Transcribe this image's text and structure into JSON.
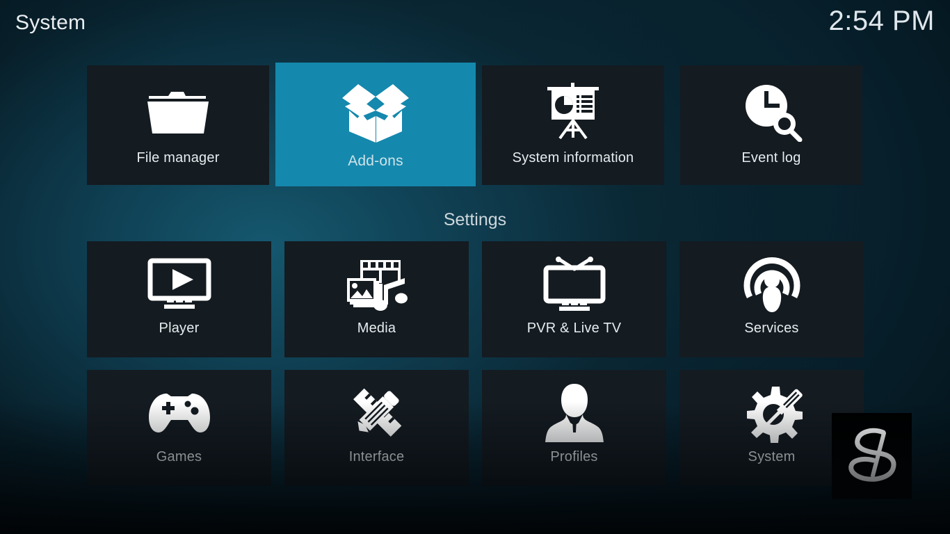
{
  "header": {
    "title": "System",
    "clock": "2:54 PM"
  },
  "colors": {
    "accent": "#1588ad",
    "tile_bg": "#141b21",
    "text": "#e6ecef",
    "background_dark": "#041520"
  },
  "top_row": [
    {
      "label": "File manager",
      "icon": "folder-icon",
      "selected": false
    },
    {
      "label": "Add-ons",
      "icon": "open-box-icon",
      "selected": true
    },
    {
      "label": "System information",
      "icon": "presentation-icon",
      "selected": false
    },
    {
      "label": "Event log",
      "icon": "clock-search-icon",
      "selected": false
    }
  ],
  "settings_section": {
    "label": "Settings",
    "items": [
      {
        "label": "Player",
        "icon": "monitor-play-icon"
      },
      {
        "label": "Media",
        "icon": "media-collage-icon"
      },
      {
        "label": "PVR & Live TV",
        "icon": "tv-antenna-icon"
      },
      {
        "label": "Services",
        "icon": "broadcast-icon"
      },
      {
        "label": "Games",
        "icon": "gamepad-icon"
      },
      {
        "label": "Interface",
        "icon": "pencil-ruler-icon"
      },
      {
        "label": "Profiles",
        "icon": "person-bust-icon"
      },
      {
        "label": "System",
        "icon": "gear-screwdriver-icon"
      }
    ]
  },
  "watermark": {
    "icon": "stylized-s-logo"
  }
}
